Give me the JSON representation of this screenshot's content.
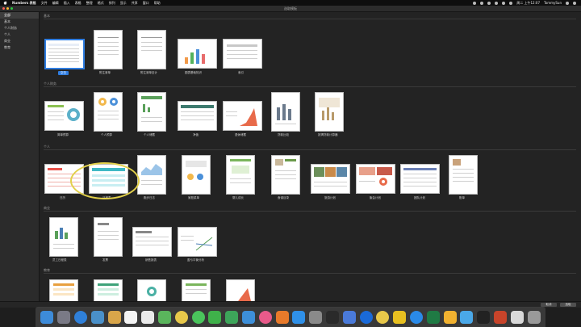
{
  "menubar": {
    "app_name": "Numbers 表格",
    "items": [
      "文件",
      "编辑",
      "插入",
      "表格",
      "整理",
      "格式",
      "排列",
      "显示",
      "共享",
      "窗口",
      "帮助"
    ],
    "right_date": "周二 上午12:07",
    "right_user": "TommySun"
  },
  "window": {
    "title": "选取模板"
  },
  "sidebar": {
    "items": [
      {
        "label": "全部",
        "active": true
      },
      {
        "label": "基本",
        "active": false
      },
      {
        "label": "个人财务",
        "active": false
      },
      {
        "label": "个人",
        "active": false
      },
      {
        "label": "商业",
        "active": false
      },
      {
        "label": "教育",
        "active": false
      }
    ]
  },
  "sections": {
    "basic": {
      "label": "基本",
      "templates": [
        {
          "label": "空白",
          "selected": true
        },
        {
          "label": "附注清单"
        },
        {
          "label": "附注清单至计"
        },
        {
          "label": "图表基础知识"
        },
        {
          "label": "索引"
        }
      ]
    },
    "finance": {
      "label": "个人财务",
      "templates": [
        {
          "label": "简单预算"
        },
        {
          "label": "个人预算"
        },
        {
          "label": "个人储蓄"
        },
        {
          "label": "净值"
        },
        {
          "label": "退休储蓄"
        },
        {
          "label": "贷款比较"
        },
        {
          "label": "按揭贷款计算器"
        }
      ]
    },
    "personal": {
      "label": "个人",
      "templates": [
        {
          "label": "日历"
        },
        {
          "label": "日程表"
        },
        {
          "label": "跑步日志"
        },
        {
          "label": "家庭菜单"
        },
        {
          "label": "婴儿成长"
        },
        {
          "label": "食谱目录"
        },
        {
          "label": "旅游计划"
        },
        {
          "label": "聚会计划"
        },
        {
          "label": "团队计划"
        },
        {
          "label": "账单"
        }
      ]
    },
    "business": {
      "label": "商业",
      "templates": [
        {
          "label": "员工日程表"
        },
        {
          "label": "发票"
        },
        {
          "label": "销售报表"
        },
        {
          "label": "盈亏平衡分析"
        }
      ]
    },
    "education": {
      "label": "教育",
      "templates": [
        {
          "label": ""
        },
        {
          "label": ""
        },
        {
          "label": ""
        },
        {
          "label": ""
        },
        {
          "label": ""
        }
      ]
    }
  },
  "footer": {
    "cancel_label": "取消",
    "choose_label": "选取"
  },
  "dock": {
    "icons": [
      "finder-icon",
      "launchpad-icon",
      "safari-icon",
      "photos-icon",
      "notes-icon",
      "calendar-icon",
      "reminders-icon",
      "maps-icon",
      "photos-app-icon",
      "messages-icon",
      "facetime-icon",
      "numbers-icon",
      "keynote-icon",
      "itunes-icon",
      "books-icon",
      "app-store-icon",
      "system-preferences-icon",
      "terminal-icon",
      "finder-alt-icon",
      "onepassword-icon",
      "chrome-icon",
      "butterfly-app-icon",
      "qq-icon",
      "excel-icon",
      "sketch-icon",
      "mail-icon",
      "qq-penguin-icon",
      "powerpoint-icon",
      "preview-icon",
      "trash-icon"
    ]
  }
}
